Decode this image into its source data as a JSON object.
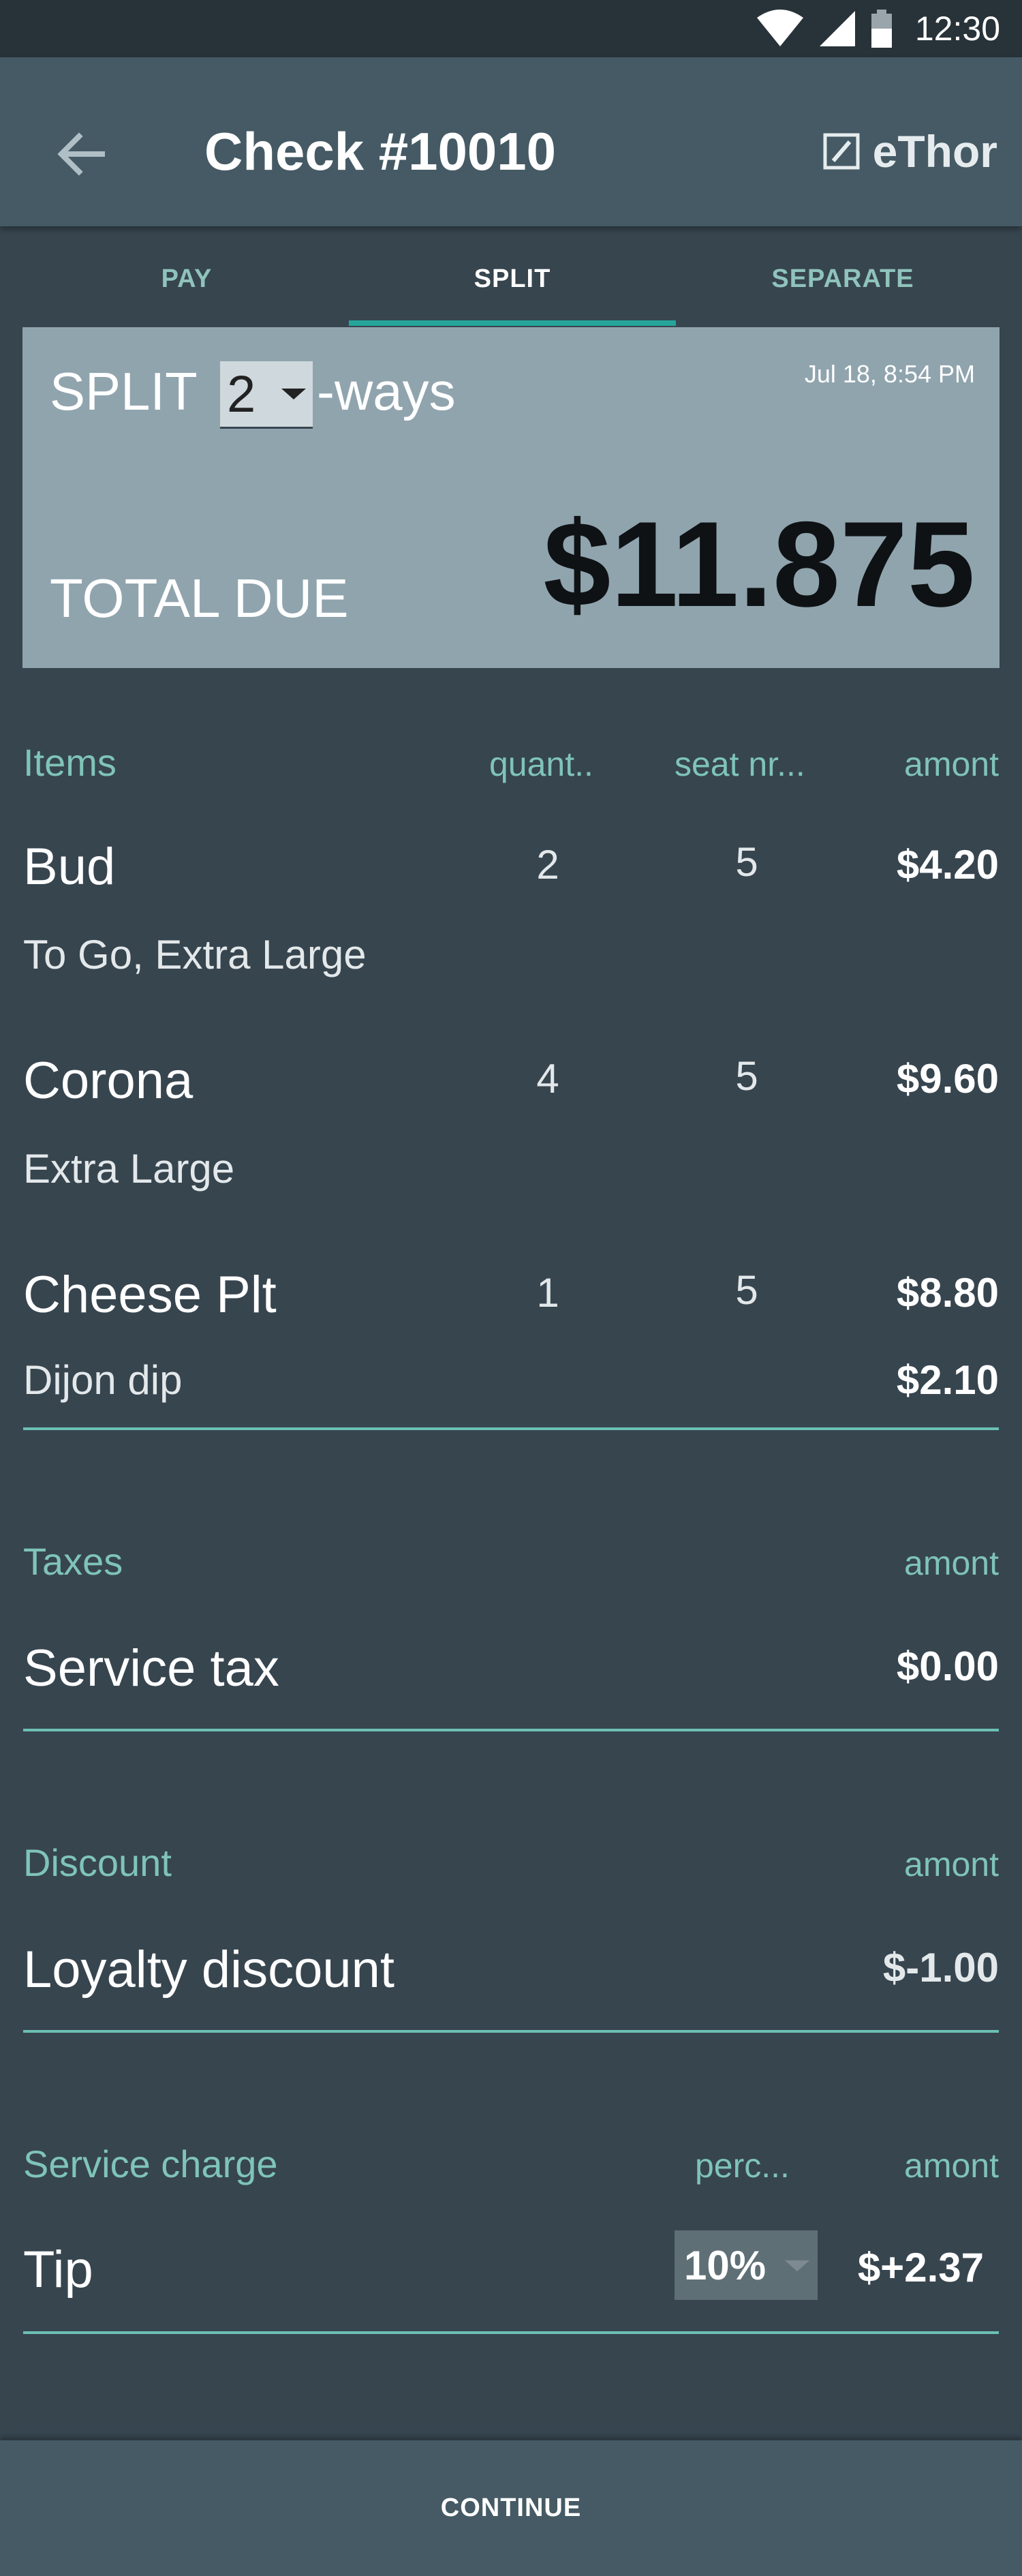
{
  "status_bar": {
    "time": "12:30",
    "icons": [
      "wifi-icon",
      "signal-icon",
      "battery-icon"
    ]
  },
  "header": {
    "title": "Check #10010",
    "brand": "eThor",
    "back_icon": "arrow-left-icon",
    "brand_icon": "ethor-logo-icon"
  },
  "tabs": [
    {
      "label": "PAY",
      "active": false
    },
    {
      "label": "SPLIT",
      "active": true
    },
    {
      "label": "SEPARATE",
      "active": false
    }
  ],
  "summary": {
    "split_prefix": "SPLIT",
    "split_ways": "2",
    "split_suffix": "-ways",
    "date": "Jul 18, 8:54 PM",
    "total_label": "TOTAL DUE",
    "total_amount": "$11.875"
  },
  "items_section": {
    "title": "Items",
    "col_quantity": "quant..",
    "col_seat": "seat nr...",
    "col_amount": "amont",
    "items": [
      {
        "name": "Bud",
        "quantity": "2",
        "seat": "5",
        "amount": "$4.20",
        "modifiers": [
          {
            "text": "To Go, Extra Large",
            "amount": ""
          }
        ]
      },
      {
        "name": "Corona",
        "quantity": "4",
        "seat": "5",
        "amount": "$9.60",
        "modifiers": [
          {
            "text": "Extra Large",
            "amount": ""
          }
        ]
      },
      {
        "name": "Cheese Plt",
        "quantity": "1",
        "seat": "5",
        "amount": "$8.80",
        "modifiers": [
          {
            "text": "Dijon dip",
            "amount": "$2.10"
          }
        ]
      }
    ]
  },
  "taxes_section": {
    "title": "Taxes",
    "col_amount": "amont",
    "rows": [
      {
        "name": "Service tax",
        "amount": "$0.00"
      }
    ]
  },
  "discount_section": {
    "title": "Discount",
    "col_amount": "amont",
    "rows": [
      {
        "name": "Loyalty discount",
        "amount": "$-1.00"
      }
    ]
  },
  "service_charge_section": {
    "title": "Service charge",
    "col_percent": "perc...",
    "col_amount": "amont",
    "rows": [
      {
        "name": "Tip",
        "percent": "10%",
        "amount": "$+2.37"
      }
    ]
  },
  "footer": {
    "continue_label": "CONTINUE"
  },
  "colors": {
    "accent": "#26a69a",
    "header_teal": "#7fc4b8",
    "background": "#37454f",
    "app_bar": "#455a64",
    "summary_card": "#90a4ae"
  }
}
